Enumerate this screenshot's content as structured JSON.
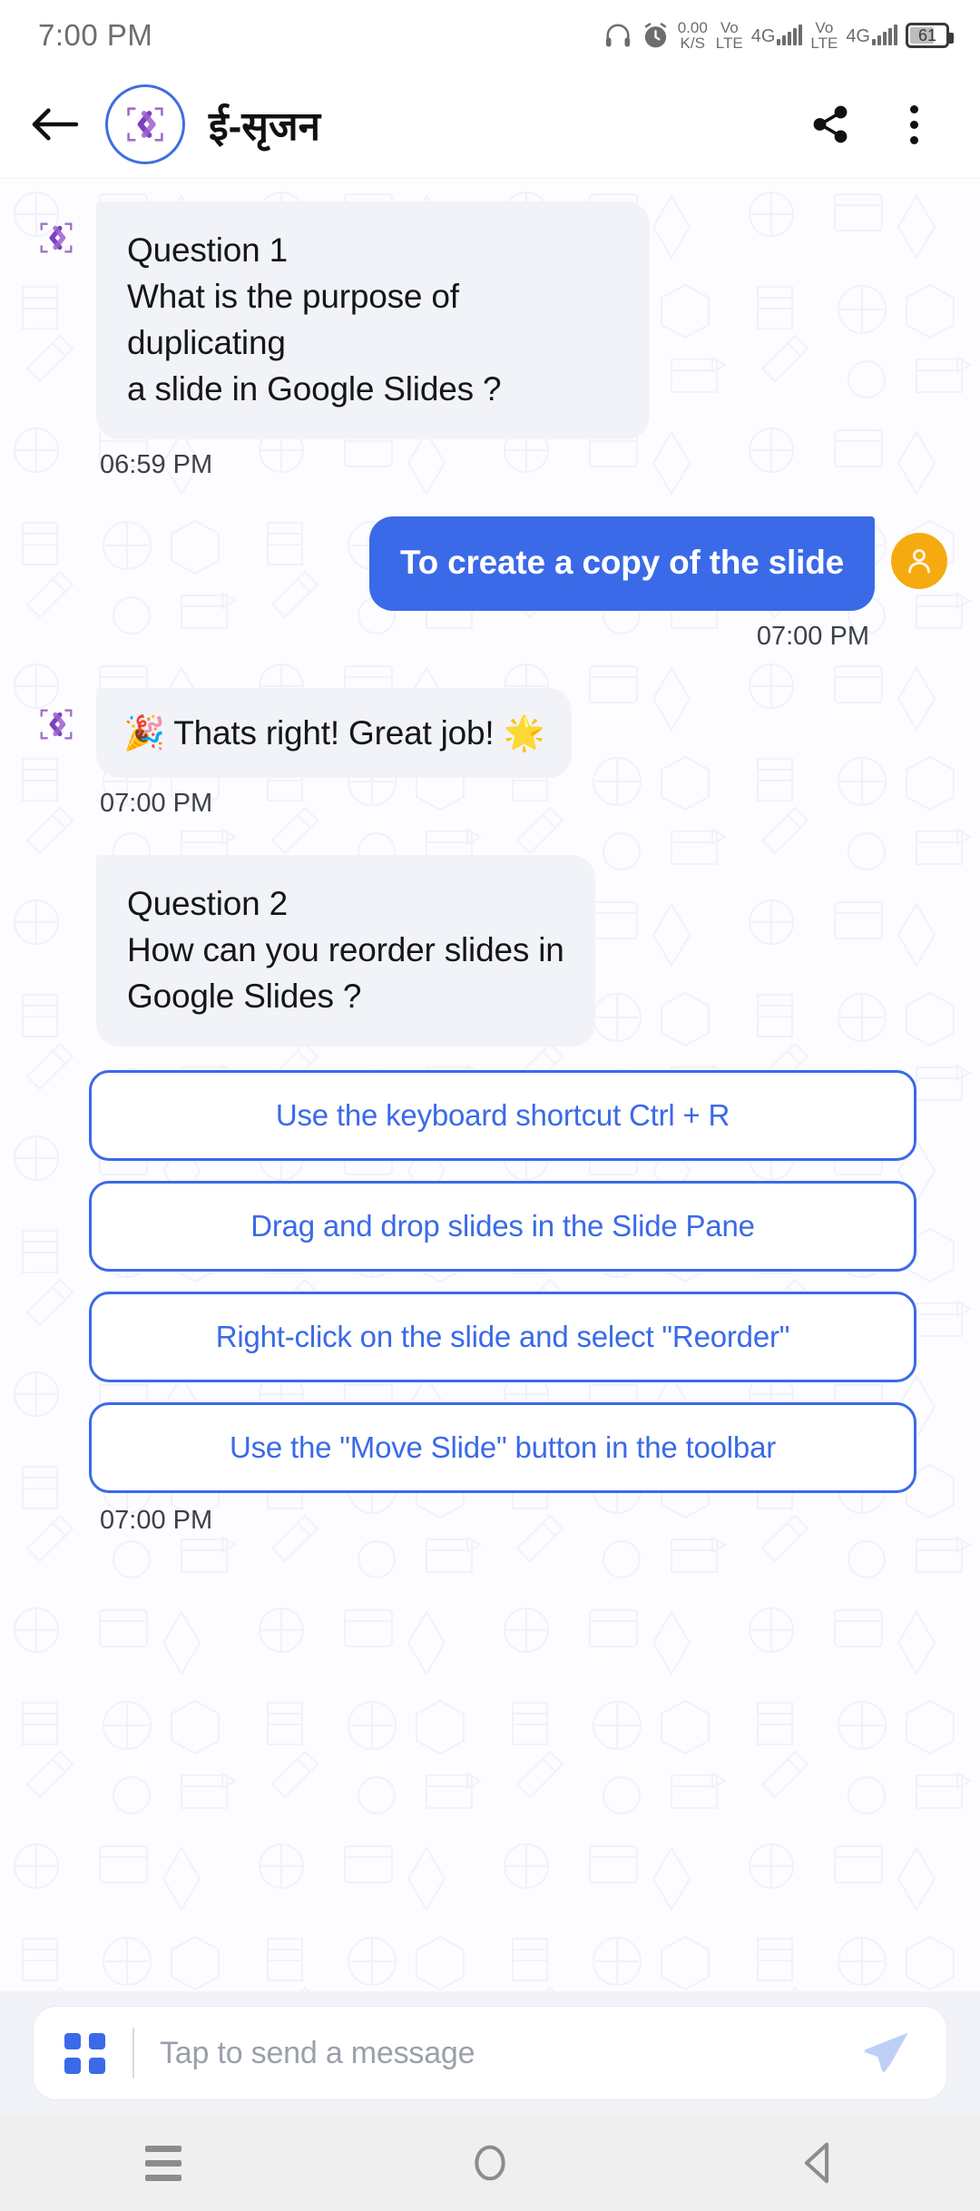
{
  "status_bar": {
    "time": "7:00 PM",
    "net_speed_value": "0.00",
    "net_speed_unit": "K/S",
    "sim1_volte_top": "Vo",
    "sim1_volte_bottom": "LTE",
    "sim1_network": "4G",
    "sim2_volte_top": "Vo",
    "sim2_volte_bottom": "LTE",
    "sim2_network": "4G",
    "battery_percent": "61",
    "icons": [
      "headphones-icon",
      "alarm-clock-icon",
      "signal-icon",
      "battery-icon"
    ]
  },
  "app_bar": {
    "back_icon": "back-arrow-icon",
    "avatar_icon": "brand-logo-icon",
    "title": "ई-सृजन",
    "share_icon": "share-icon",
    "menu_icon": "more-options-icon"
  },
  "chat": {
    "messages": [
      {
        "id": "q1",
        "sender": "bot",
        "line1": "Question 1",
        "line2": "What is the purpose of duplicating",
        "line3": "a slide in Google Slides ?",
        "timestamp": "06:59 PM"
      },
      {
        "id": "a1",
        "sender": "user",
        "text": "To create a copy of the slide",
        "timestamp": "07:00 PM"
      },
      {
        "id": "feedback",
        "sender": "bot",
        "text": "🎉 Thats right! Great job! 🌟",
        "timestamp": "07:00 PM"
      },
      {
        "id": "q2",
        "sender": "bot",
        "line1": "Question 2",
        "line2": "How can you reorder slides in",
        "line3": "Google Slides ?",
        "timestamp": "07:00 PM"
      }
    ],
    "options": [
      "Use the keyboard shortcut Ctrl + R",
      "Drag and drop slides in the Slide Pane",
      "Right-click on the slide and select \"Reorder\"",
      "Use the \"Move Slide\" button in the toolbar"
    ]
  },
  "composer": {
    "grid_icon": "apps-grid-icon",
    "placeholder": "Tap to send a message",
    "value": "",
    "send_icon": "send-icon"
  },
  "nav_bar": {
    "recents_icon": "recents-menu-icon",
    "home_icon": "home-circle-icon",
    "back_icon": "back-triangle-icon"
  },
  "colors": {
    "accent_blue": "#3b6ae8",
    "bot_bubble": "#f1f3f8",
    "user_avatar": "#f5ab10",
    "send_icon": "#bfd0f8",
    "chat_bg": "#fdfdff"
  }
}
